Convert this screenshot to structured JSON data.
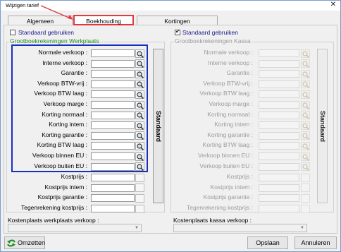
{
  "window": {
    "title": "Wijzigen tarief",
    "close": "✕"
  },
  "tabs": [
    {
      "label": "Algemeen"
    },
    {
      "label": "Boekhouding"
    },
    {
      "label": "Kortingen"
    }
  ],
  "left": {
    "checkbox_label": "Standaard gebruiken",
    "checkbox_checked": false,
    "group_title": "Grootboekrekeningen Werkplaats",
    "rows": [
      "Normale verkoop :",
      "Interne verkoop :",
      "Garantie :",
      "Verkoop BTW-vrij :",
      "Verkoop BTW laag :",
      "Verkoop marge :",
      "Korting normaal :",
      "Korting intem :",
      "Korting garantie :",
      "Korting BTW laag :",
      "Verkoop binnen EU :",
      "Verkoop buiten EU :"
    ],
    "extra_rows": [
      "Kostprijs :",
      "Kostprijs intem :",
      "Kostprijs garantie :",
      "Tegenrekening kostprijs :"
    ],
    "standard_button": "Standaard"
  },
  "right": {
    "checkbox_label": "Standaard gebruiken",
    "checkbox_checked": true,
    "group_title": "Grootboekrekeningen Kassa",
    "rows": [
      "Normale verkoop :",
      "Interne verkoop :",
      "Garantie :",
      "Verkoop BTW-vrij :",
      "Verkoop BTW laag :",
      "Verkoop marge :",
      "Korting normaal :",
      "Korting intem :",
      "Korting garantie :",
      "Korting BTW laag :",
      "Verkoop binnen EU :",
      "Verkoop buiten EU :",
      "Kostprijs :",
      "Kostprijs intem :",
      "Kostprijs garantie :",
      "Tegenrekening kostprijs :"
    ],
    "standard_button": "Standaard"
  },
  "bottom": {
    "left_label": "Kostenplaats werkplaats verkoop :",
    "right_label": "Kostenplaats kassa verkoop :"
  },
  "buttons": {
    "convert": "Omzetten",
    "save": "Opslaan",
    "cancel": "Annuleren"
  },
  "colors": {
    "highlight": "#1a2fbf",
    "annotation": "#e0383e",
    "group_title": "#1e8a1e",
    "checkbox_label": "#1a1a8a"
  }
}
